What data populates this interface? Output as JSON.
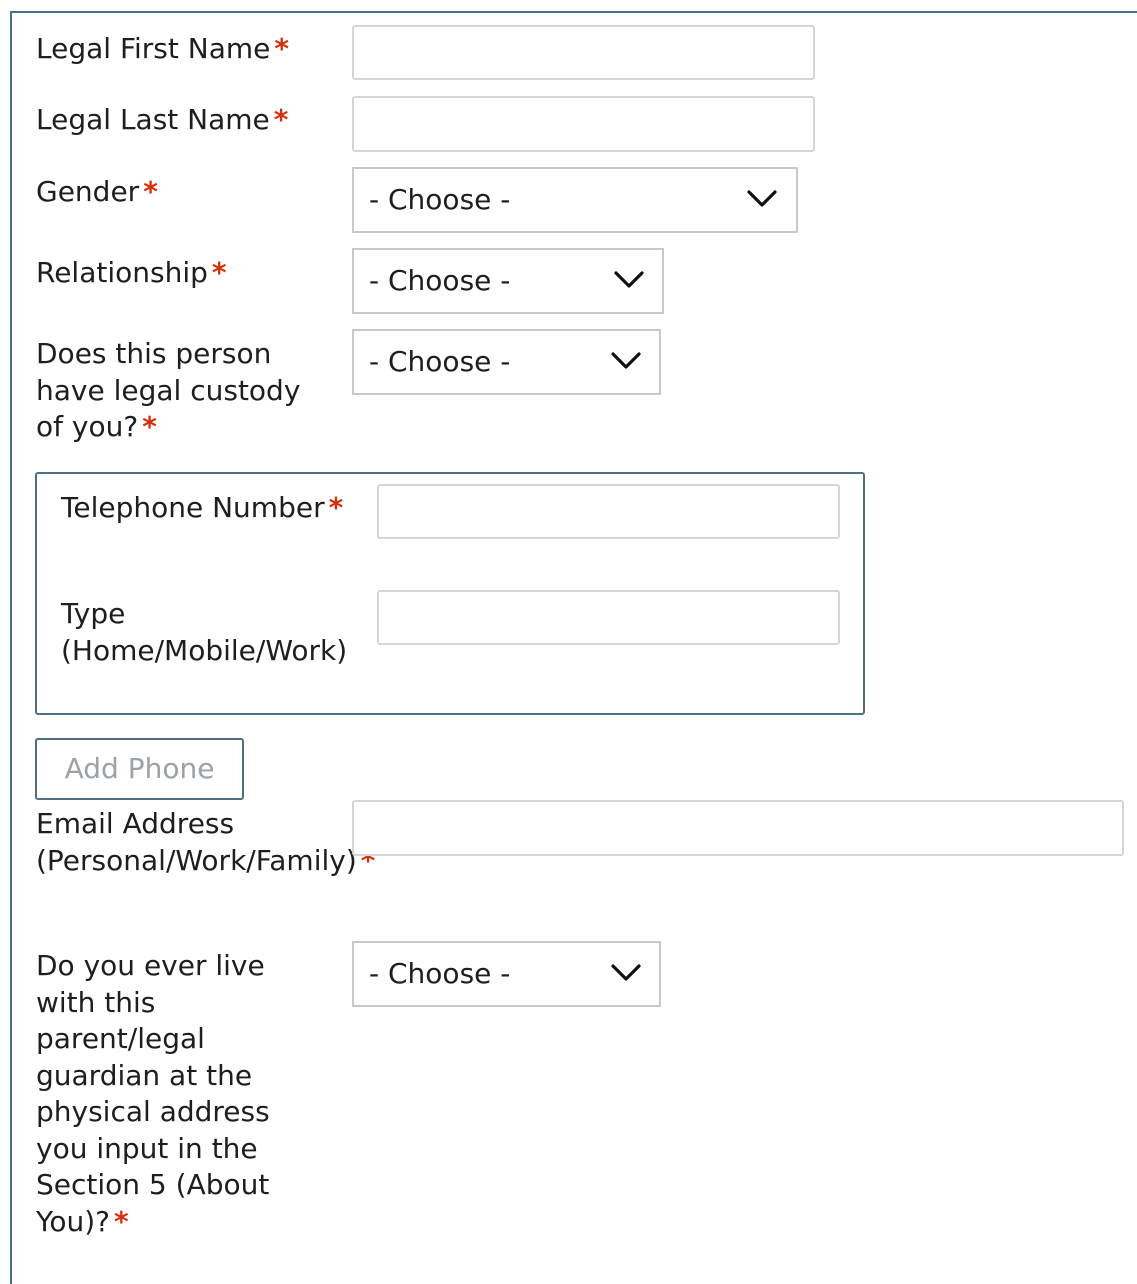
{
  "form": {
    "first_name": {
      "label": "Legal First Name",
      "required_mark": "*",
      "value": ""
    },
    "last_name": {
      "label": "Legal Last Name",
      "required_mark": "*",
      "value": ""
    },
    "gender": {
      "label": "Gender",
      "required_mark": "*",
      "selected": "- Choose -"
    },
    "relationship": {
      "label": "Relationship",
      "required_mark": "*",
      "selected": "- Choose -"
    },
    "custody": {
      "label": "Does this person have legal custody of you?",
      "required_mark": "*",
      "selected": "- Choose -"
    },
    "phone": {
      "number_label": "Telephone Number",
      "number_required_mark": "*",
      "number_value": "",
      "type_label": "Type (Home/Mobile/Work)",
      "type_value": ""
    },
    "add_phone_label": "Add Phone",
    "email": {
      "label": "Email Address (Personal/Work/Family)",
      "required_mark": "*",
      "value": ""
    },
    "live_with": {
      "label": "Do you ever live with this parent/legal guardian at the physical address you input in the Section 5 (About You)?",
      "required_mark": "*",
      "selected": "- Choose -"
    }
  },
  "colors": {
    "frame_border": "#4d6e85",
    "required_asterisk": "#d62f0b",
    "input_border": "#d5d5d5",
    "select_border": "#c9c9c9",
    "disabled_text": "#9aa3a9"
  },
  "icons": {
    "select_arrow": "chevron-down-icon"
  }
}
